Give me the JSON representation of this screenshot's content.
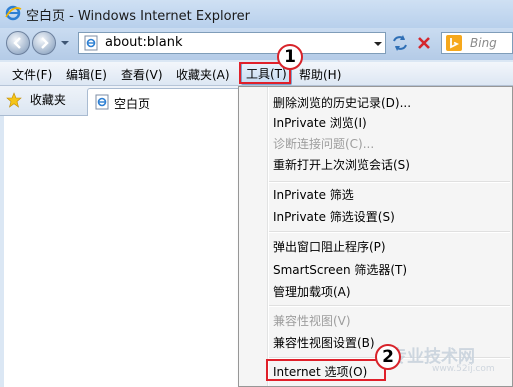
{
  "window": {
    "title": "空白页 - Windows Internet Explorer"
  },
  "address": {
    "url": "about:blank"
  },
  "search": {
    "placeholder": "Bing"
  },
  "menubar": {
    "items": [
      {
        "label": "文件(F)"
      },
      {
        "label": "编辑(E)"
      },
      {
        "label": "查看(V)"
      },
      {
        "label": "收藏夹(A)"
      },
      {
        "label": "工具(T)"
      },
      {
        "label": "帮助(H)"
      }
    ]
  },
  "favorites": {
    "label": "收藏夹"
  },
  "tab": {
    "label": "空白页"
  },
  "tools_menu": {
    "items": [
      {
        "label": "删除浏览的历史记录(D)..."
      },
      {
        "label": "InPrivate 浏览(I)"
      },
      {
        "label": "诊断连接问题(C)..."
      },
      {
        "label": "重新打开上次浏览会话(S)"
      },
      {
        "label": "InPrivate 筛选"
      },
      {
        "label": "InPrivate 筛选设置(S)"
      },
      {
        "label": "弹出窗口阻止程序(P)"
      },
      {
        "label": "SmartScreen 筛选器(T)"
      },
      {
        "label": "管理加载项(A)"
      },
      {
        "label": "兼容性视图(V)"
      },
      {
        "label": "兼容性视图设置(B)"
      },
      {
        "label": "Internet 选项(O)"
      }
    ]
  },
  "callouts": {
    "one": "1",
    "two": "2"
  },
  "watermark": {
    "text": "专业技术网",
    "url": "www.52ij.com"
  },
  "colors": {
    "highlight_border": "#e0202a",
    "menu_bg": "#f5f5f5"
  }
}
